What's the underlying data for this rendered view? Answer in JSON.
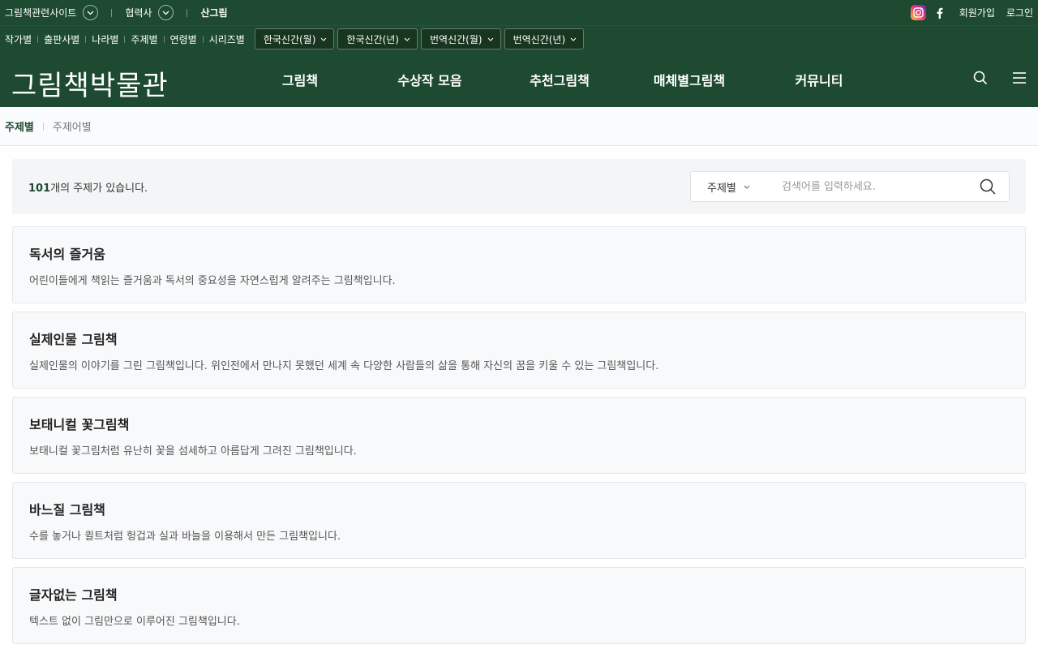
{
  "util": {
    "left": [
      {
        "label": "그림책관련사이트",
        "has_chevron": true
      },
      {
        "label": "협력사",
        "has_chevron": true
      },
      {
        "label": "산그림",
        "has_chevron": false
      }
    ],
    "signup": "회원가입",
    "login": "로그인"
  },
  "categories": {
    "links": [
      "작가별",
      "출판사별",
      "나라별",
      "주제별",
      "연령별",
      "시리즈별"
    ],
    "selects": [
      "한국신간(월)",
      "한국신간(년)",
      "번역신간(월)",
      "번역신간(년)"
    ]
  },
  "header": {
    "logo": "그림책박물관",
    "nav": [
      "그림책",
      "수상작 모음",
      "추천그림책",
      "매체별그림책",
      "커뮤니티"
    ]
  },
  "subtabs": [
    "주제별",
    "주제어별"
  ],
  "search": {
    "count_number": "101",
    "count_suffix": "개의 주제가 있습니다.",
    "select_label": "주제별",
    "placeholder": "검색어를 입력하세요."
  },
  "topics": [
    {
      "title": "독서의 즐거움",
      "desc": "어린이들에게 책읽는 즐거움과 독서의 중요성을 자연스럽게 알려주는 그림책입니다."
    },
    {
      "title": "실제인물 그림책",
      "desc": "실제인물의 이야기를 그린 그림책입니다. 위인전에서 만나지 못했던 세계 속 다양한 사람들의 삶을 통해 자신의 꿈을 키울 수 있는 그림책입니다."
    },
    {
      "title": "보태니컬 꽃그림책",
      "desc": "보태니컬 꽃그림처럼 유난히 꽃을 섬세하고 아름답게 그려진 그림책입니다."
    },
    {
      "title": "바느질 그림책",
      "desc": "수를 놓거나 퀼트처럼 헝겁과 실과 바늘을 이용해서 만든 그림책입니다."
    },
    {
      "title": "글자없는 그림책",
      "desc": "텍스트 없이 그림만으로 이루어진 그림책입니다."
    }
  ],
  "colors": {
    "brand_green": "#1d4a30"
  }
}
